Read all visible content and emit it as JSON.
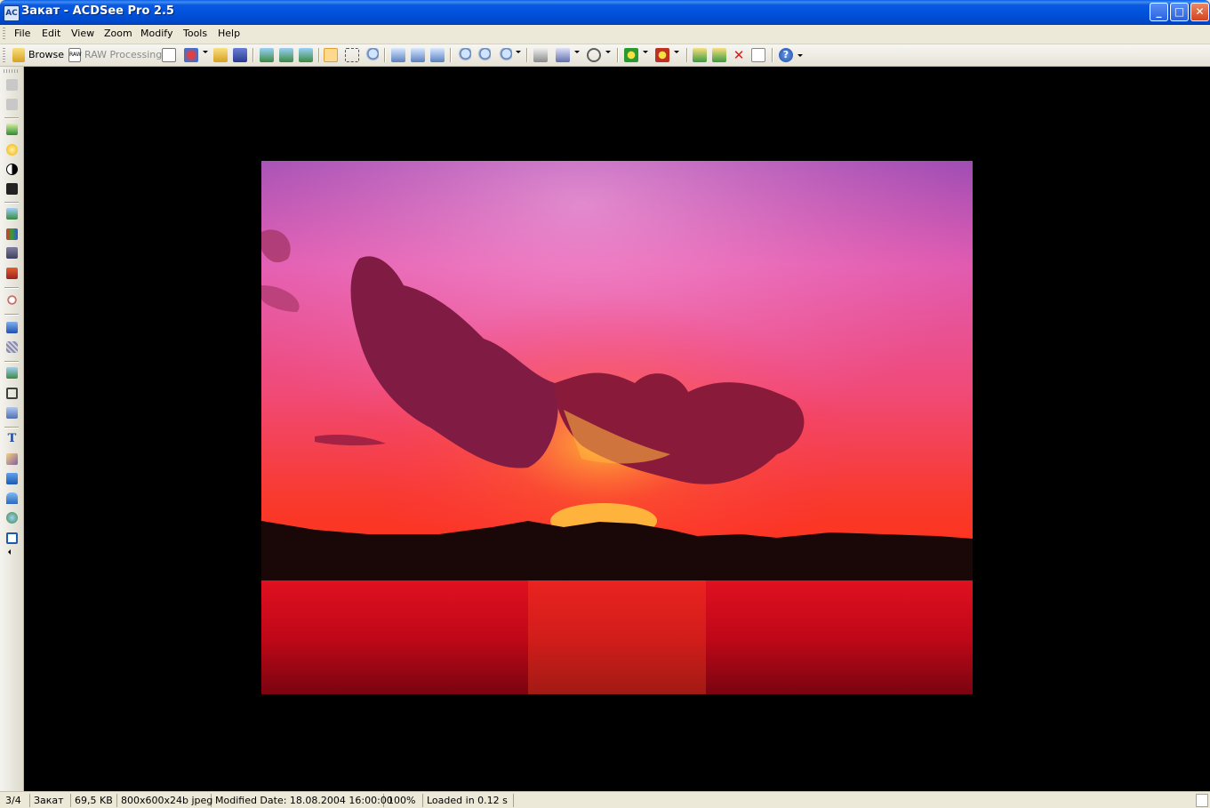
{
  "window": {
    "title": "Закат - ACDSee Pro 2.5",
    "app_icon_label": "AC",
    "controls": {
      "minimize": "_",
      "maximize": "□",
      "close": "✕"
    }
  },
  "menu": [
    {
      "label": "File"
    },
    {
      "label": "Edit"
    },
    {
      "label": "View"
    },
    {
      "label": "Zoom"
    },
    {
      "label": "Modify"
    },
    {
      "label": "Tools"
    },
    {
      "label": "Help"
    }
  ],
  "toolbar": {
    "browse_label": "Browse",
    "raw_label": "RAW Processing",
    "icons": [
      "raw-icon",
      "edit-icon",
      "open-folder-icon",
      "save-icon",
      "previous-image-icon",
      "next-image-icon",
      "slideshow-icon",
      "hand-tool-icon",
      "select-tool-icon",
      "zoom-tool-icon",
      "rotate-left-icon",
      "rotate-right-icon",
      "flip-icon",
      "zoom-in-icon",
      "zoom-out-icon",
      "zoom-icon",
      "print-icon",
      "send-icon",
      "filter-icon",
      "batch-icon",
      "color-icon",
      "move-to-icon",
      "copy-to-icon",
      "delete-icon",
      "properties-icon",
      "help-icon"
    ]
  },
  "left_tools": [
    "undo-icon",
    "redo-icon",
    "auto-exposure-icon",
    "lighting-icon",
    "levels-icon",
    "curves-icon",
    "color-balance-icon",
    "hue-icon",
    "photo-repair-icon",
    "red-eye-icon",
    "sharpen-icon",
    "noise-icon",
    "resize-icon",
    "crop-icon",
    "rotate-icon",
    "text-icon",
    "repair-icon",
    "perspective-icon",
    "distort-icon",
    "effects-icon",
    "border-icon"
  ],
  "image": {
    "filename": "Закат"
  },
  "status": {
    "index": "3/4",
    "name": "Закат",
    "size": "69,5 KB",
    "dims": "800x600x24b jpeg",
    "modified": "Modified Date: 18.08.2004 16:00:00",
    "zoom": "100%",
    "loaded": "Loaded in 0.12 s"
  },
  "colors": {
    "sky_top": "#a050b8",
    "sky_mid": "#f060a0",
    "sun": "#ffb020",
    "water": "#c01020",
    "viewer_bg": "#000000"
  }
}
